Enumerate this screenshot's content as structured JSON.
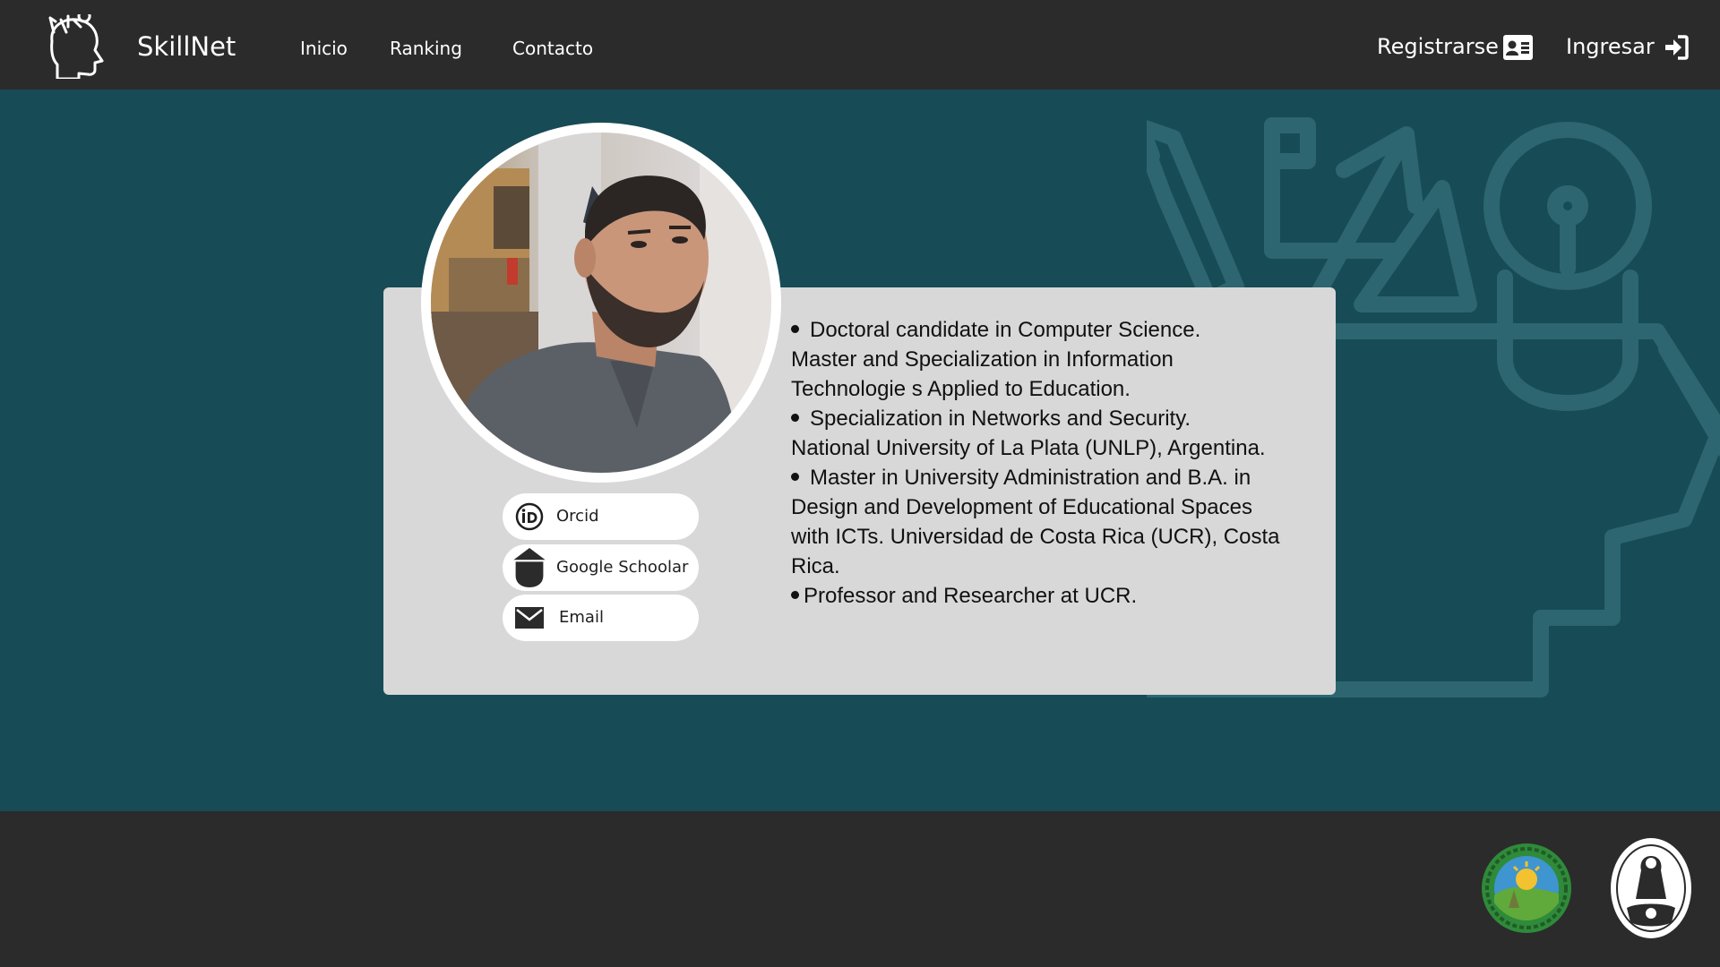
{
  "navbar": {
    "brand": "SkillNet",
    "links": [
      "Inicio",
      "Ranking",
      "Contacto"
    ],
    "register_label": "Registrarse",
    "login_label": "Ingresar",
    "icons": {
      "logo": "head-with-ideas-icon",
      "register": "id-card-icon",
      "login": "sign-in-icon"
    }
  },
  "profile": {
    "links": [
      {
        "label": "Orcid",
        "icon": "orcid-icon"
      },
      {
        "label": "Google Schoolar",
        "icon": "graduation-cap-icon"
      },
      {
        "label": "Email",
        "icon": "envelope-icon"
      }
    ],
    "bio_lines": [
      "Doctoral candidate in Computer Science.",
      "Master and Specialization in Information",
      "Technologie s Applied to Education.",
      "Specialization in Networks and Security.",
      "National University of La Plata (UNLP), Argentina.",
      "Master in University Administration and B.A. in",
      "Design and Development of Educational Spaces",
      "with ICTs. Universidad de Costa Rica (UCR), Costa",
      "Rica.",
      "Professor and Researcher at UCR."
    ]
  },
  "footer": {
    "seals": [
      "ucr-seal-icon",
      "unlp-seal-icon"
    ]
  },
  "colors": {
    "navbar_bg": "#2b2b2b",
    "main_bg": "#174b55",
    "card_bg": "#d8d8d8",
    "illustration": "#2d6670",
    "text_light": "#ffffff",
    "text_dark": "#111111"
  }
}
